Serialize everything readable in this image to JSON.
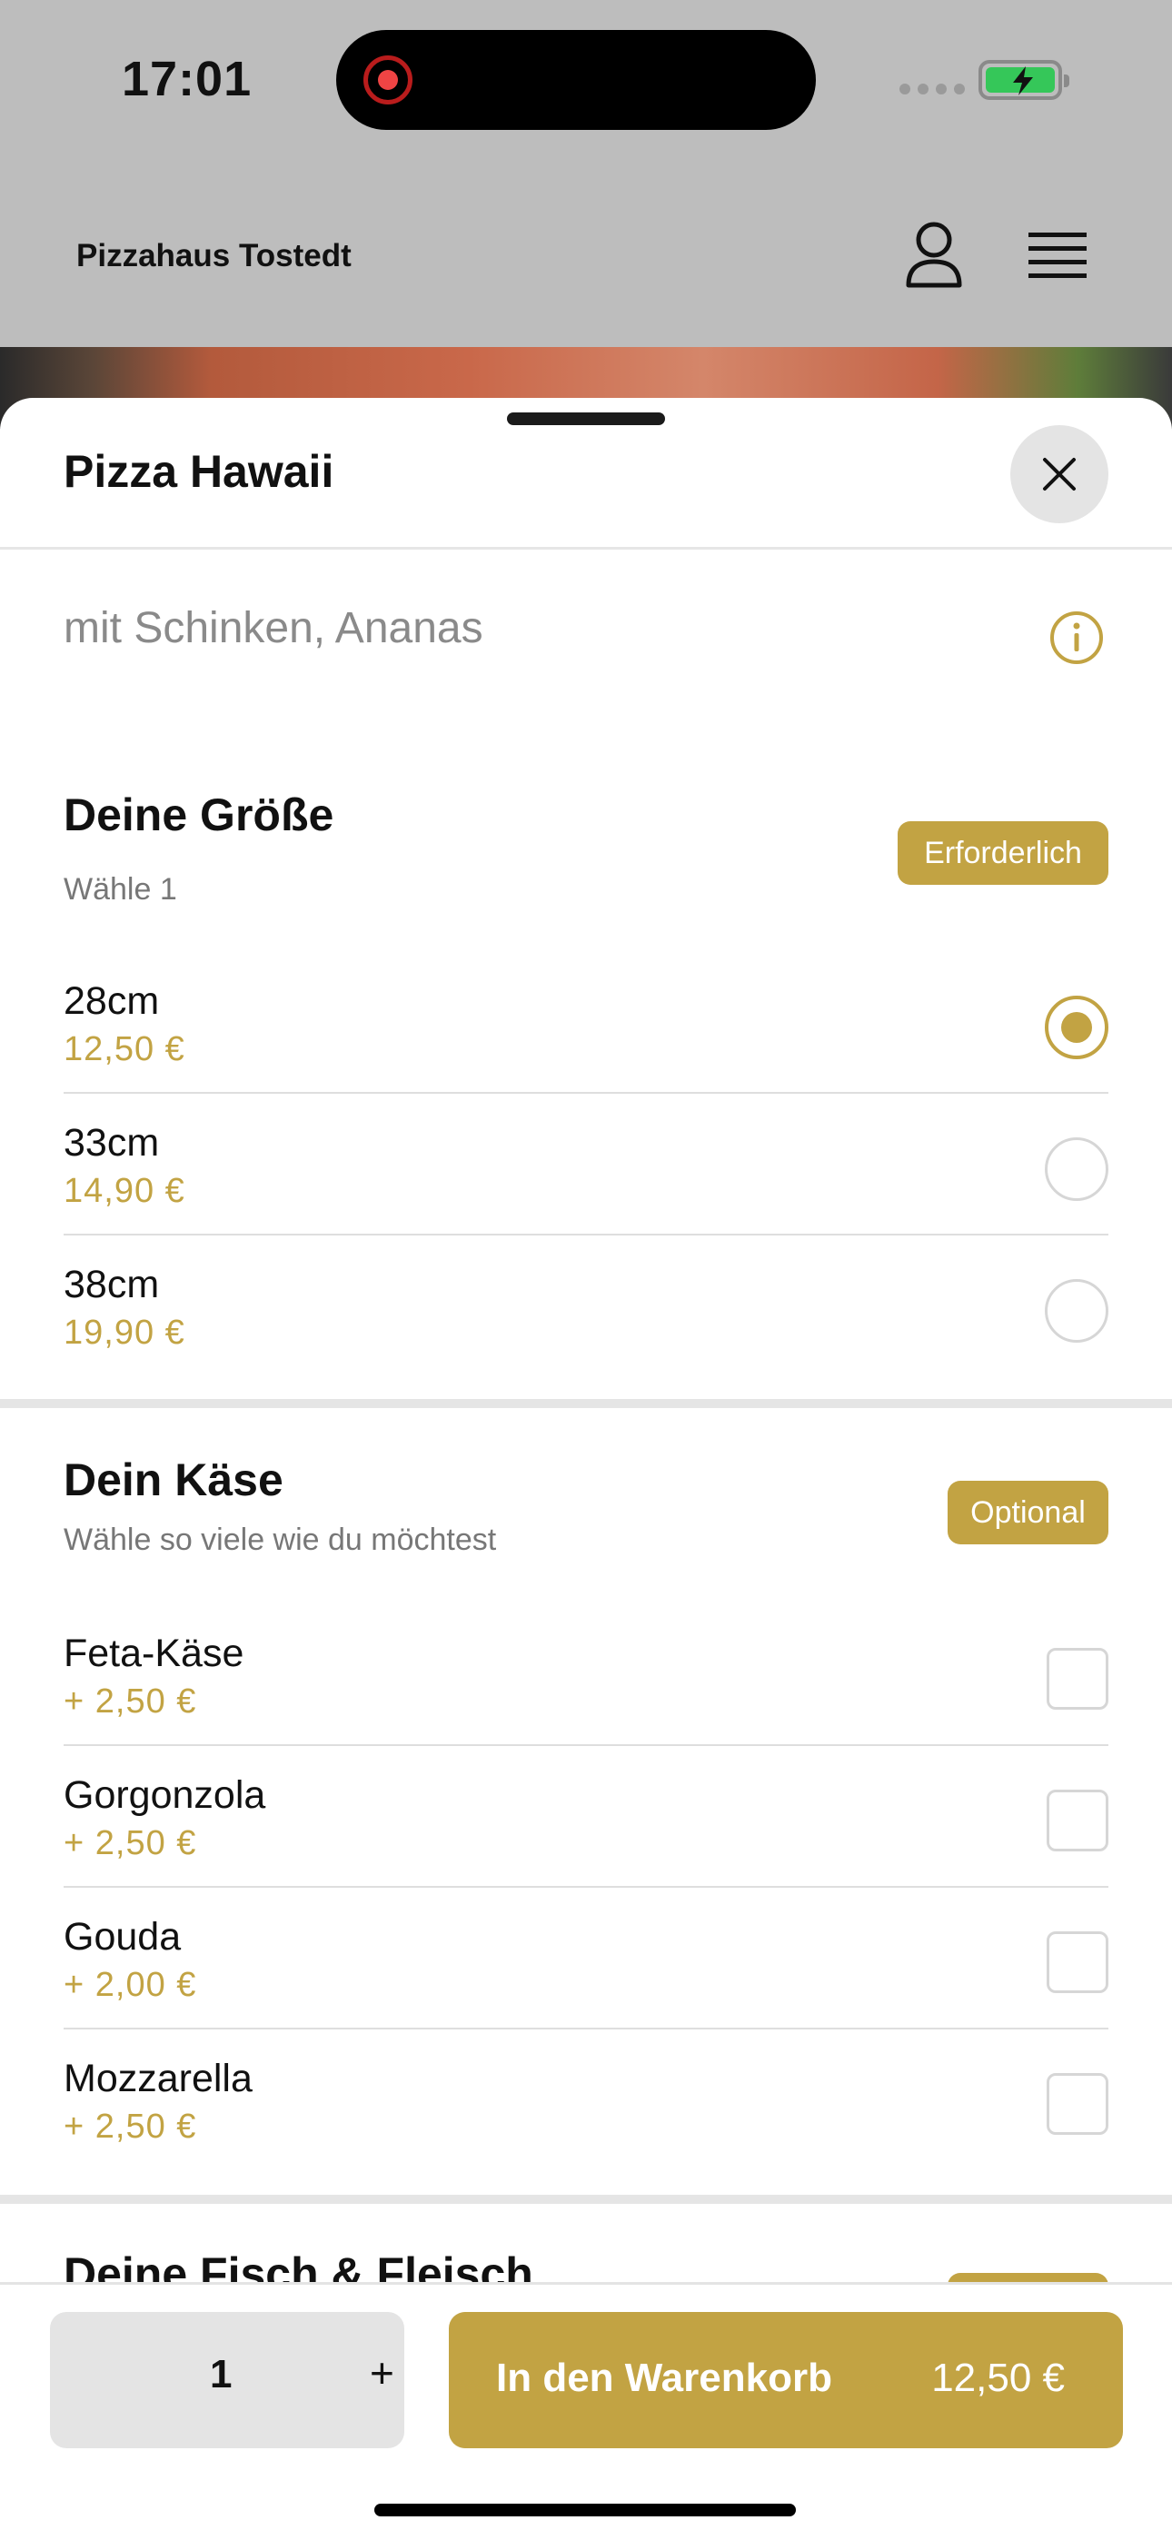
{
  "status": {
    "time": "17:01"
  },
  "header": {
    "brand": "Pizzahaus Tostedt"
  },
  "sheet": {
    "title": "Pizza Hawaii",
    "description": "mit Schinken, Ananas"
  },
  "size_section": {
    "title": "Deine Größe",
    "subtitle": "Wähle 1",
    "badge": "Erforderlich",
    "options": [
      {
        "name": "28cm",
        "price": "12,50 €",
        "selected": true
      },
      {
        "name": "33cm",
        "price": "14,90 €",
        "selected": false
      },
      {
        "name": "38cm",
        "price": "19,90 €",
        "selected": false
      }
    ]
  },
  "cheese_section": {
    "title": "Dein Käse",
    "subtitle": "Wähle so viele wie du möchtest",
    "badge": "Optional",
    "options": [
      {
        "name": "Feta-Käse",
        "price": "+ 2,50 €"
      },
      {
        "name": "Gorgonzola",
        "price": "+ 2,50 €"
      },
      {
        "name": "Gouda",
        "price": "+ 2,00 €"
      },
      {
        "name": "Mozzarella",
        "price": "+ 2,50 €"
      }
    ]
  },
  "next_section": {
    "title": "Deine Fisch & Fleisch"
  },
  "footer": {
    "quantity": "1",
    "plus": "+",
    "cart_label": "In den Warenkorb",
    "cart_price": "12,50 €"
  },
  "colors": {
    "accent": "#c2a343"
  }
}
